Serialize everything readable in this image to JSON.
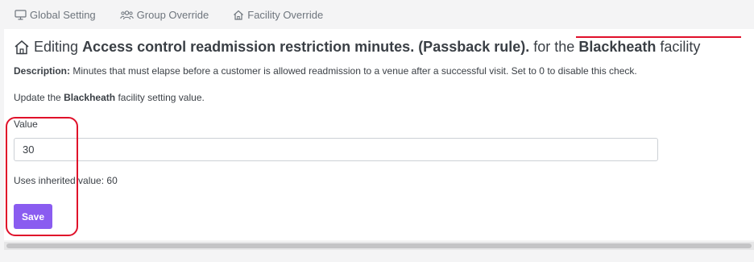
{
  "tabs": [
    {
      "label": "Global Setting",
      "icon": "monitor-icon"
    },
    {
      "label": "Group Override",
      "icon": "users-icon"
    },
    {
      "label": "Facility Override",
      "icon": "home-icon"
    }
  ],
  "heading": {
    "prefix": "Editing",
    "setting_name": "Access control readmission restriction minutes. (Passback rule).",
    "middle": "for the",
    "facility": "Blackheath",
    "suffix": "facility"
  },
  "description": {
    "label": "Description:",
    "text": "Minutes that must elapse before a customer is allowed readmission to a venue after a successful visit. Set to 0 to disable this check."
  },
  "update": {
    "prefix": "Update the",
    "facility": "Blackheath",
    "suffix": "facility setting value."
  },
  "form": {
    "value_label": "Value",
    "value": "30",
    "inherited_text": "Uses inherited value: 60",
    "save_label": "Save"
  },
  "colors": {
    "accent": "#8a5cf0",
    "annotation": "#e0102a"
  }
}
